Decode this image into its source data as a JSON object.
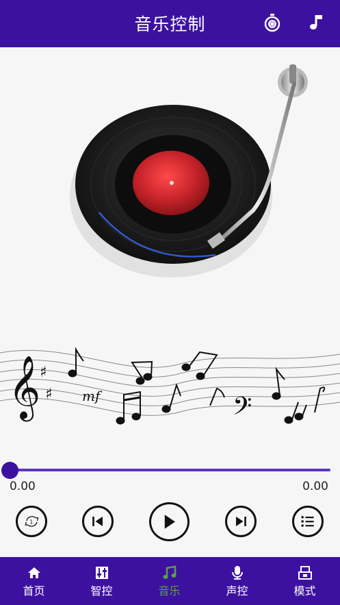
{
  "header": {
    "title": "音乐控制",
    "timer_icon": "timer-icon",
    "music_icon": "music-note-icon"
  },
  "player": {
    "progress": 0,
    "current_time": "0.00",
    "total_time": "0.00"
  },
  "controls": [
    {
      "name": "repeat-one-button",
      "icon": "repeat-one-icon",
      "repeat_label": "1"
    },
    {
      "name": "previous-button",
      "icon": "skip-previous-icon"
    },
    {
      "name": "play-button",
      "icon": "play-icon"
    },
    {
      "name": "next-button",
      "icon": "skip-next-icon"
    },
    {
      "name": "playlist-button",
      "icon": "list-icon"
    }
  ],
  "staff": {
    "dynamic_marking": "mf"
  },
  "nav": {
    "items": [
      {
        "label": "首页",
        "icon": "home-icon",
        "active": false
      },
      {
        "label": "智控",
        "icon": "sliders-icon",
        "active": false
      },
      {
        "label": "音乐",
        "icon": "music-icon",
        "active": true
      },
      {
        "label": "声控",
        "icon": "microphone-icon",
        "active": false
      },
      {
        "label": "模式",
        "icon": "mode-icon",
        "active": false
      }
    ]
  },
  "colors": {
    "primary": "#3d11a0",
    "active_tab": "#5aa04a",
    "record_label": "#c8242b"
  }
}
